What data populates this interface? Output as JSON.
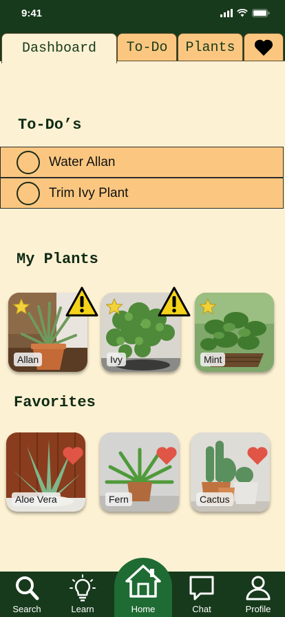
{
  "status_bar": {
    "time": "9:41"
  },
  "tabs": [
    {
      "label": "Dashboard",
      "active": true
    },
    {
      "label": "To-Do"
    },
    {
      "label": "Plants"
    },
    {
      "icon": "heart-icon"
    }
  ],
  "todos": {
    "title": "To-Do’s",
    "items": [
      {
        "label": "Water Allan",
        "checked": false
      },
      {
        "label": "Trim Ivy Plant",
        "checked": false
      }
    ]
  },
  "my_plants": {
    "title": "My Plants",
    "items": [
      {
        "label": "Allan",
        "starred": true,
        "warning": true
      },
      {
        "label": "Ivy",
        "starred": true,
        "warning": true
      },
      {
        "label": "Mint",
        "starred": true,
        "warning": false
      }
    ]
  },
  "favorites": {
    "title": "Favorites",
    "items": [
      {
        "label": "Aloe Vera",
        "favorite": true
      },
      {
        "label": "Fern",
        "favorite": true
      },
      {
        "label": "Cactus",
        "favorite": true
      }
    ]
  },
  "bottom_nav": [
    {
      "label": "Search",
      "icon": "search-icon"
    },
    {
      "label": "Learn",
      "icon": "lightbulb-icon"
    },
    {
      "label": "Home",
      "icon": "home-icon",
      "active": true
    },
    {
      "label": "Chat",
      "icon": "chat-icon"
    },
    {
      "label": "Profile",
      "icon": "profile-icon"
    }
  ],
  "colors": {
    "dark_green": "#173a1c",
    "home_green": "#1f6b34",
    "cream": "#fdf1d3",
    "tab_orange": "#fbc780",
    "heart_red": "#e05545",
    "star_yellow": "#f2d13a"
  }
}
